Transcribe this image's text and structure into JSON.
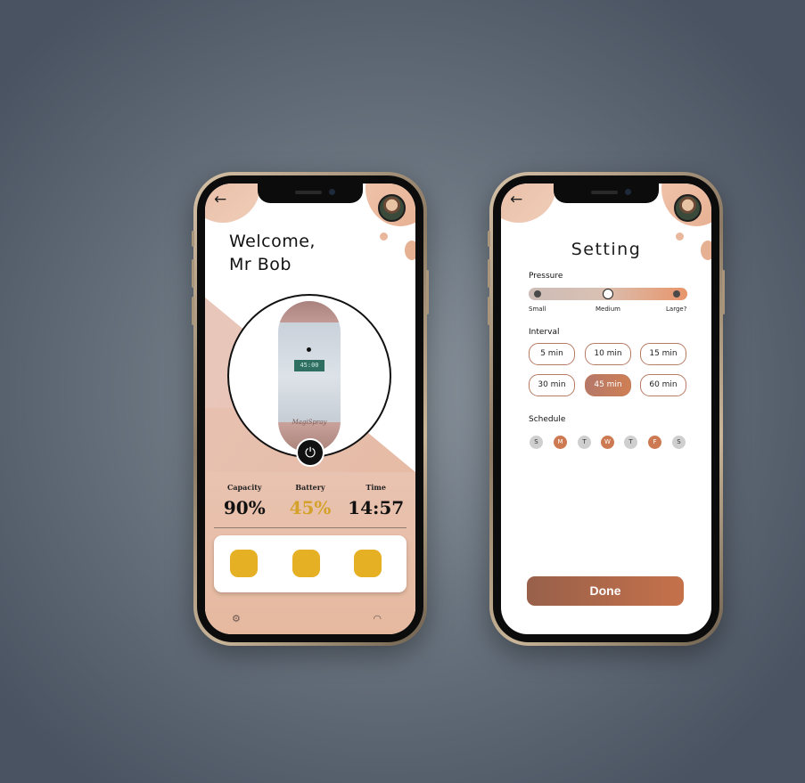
{
  "screen_home": {
    "brand": "MagiSpray",
    "back_icon": "←",
    "welcome_line1": "Welcome,",
    "welcome_line2": "Mr Bob",
    "device": {
      "display": "45:00",
      "brand": "MagiSpray"
    },
    "power_icon": "⏻",
    "stats": [
      {
        "label": "Capacity",
        "value": "90%"
      },
      {
        "label": "Battery",
        "value": "45%"
      },
      {
        "label": "Time",
        "value": "14:57"
      }
    ],
    "footer": {
      "settings_icon": "⚙",
      "wifi_icon": "◠"
    }
  },
  "screen_settings": {
    "brand": "MagiSpray",
    "back_icon": "←",
    "title": "Setting",
    "pressure": {
      "label": "Pressure",
      "options": [
        "Small",
        "Medium",
        "Large?"
      ],
      "selected": "Medium"
    },
    "interval": {
      "label": "Interval",
      "options": [
        "5 min",
        "10 min",
        "15 min",
        "30 min",
        "45 min",
        "60 min"
      ],
      "selected": "45 min"
    },
    "schedule": {
      "label": "Schedule",
      "days": [
        "S",
        "M",
        "T",
        "W",
        "T",
        "F",
        "S"
      ],
      "active": [
        false,
        true,
        false,
        true,
        false,
        true,
        false
      ]
    },
    "done_label": "Done"
  },
  "colors": {
    "accent": "#cd7a52",
    "peach": "#e8bfa8",
    "gold": "#d4a22a",
    "button_yellow": "#e5b024"
  }
}
